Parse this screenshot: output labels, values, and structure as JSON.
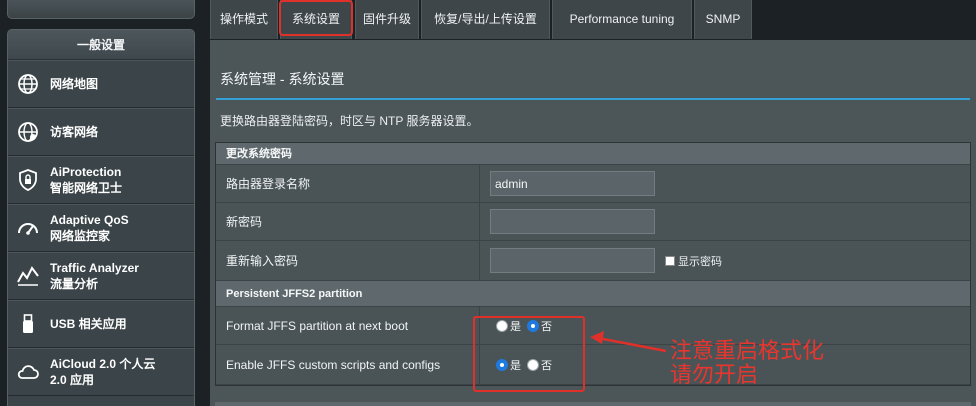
{
  "sidebar": {
    "header": "一般设置",
    "items": [
      {
        "icon": "globe-map-icon",
        "label": "网络地图",
        "sub": ""
      },
      {
        "icon": "guest-network-icon",
        "label": "访客网络",
        "sub": ""
      },
      {
        "icon": "shield-lock-icon",
        "label": "AiProtection",
        "sub": "智能网络卫士"
      },
      {
        "icon": "speedometer-icon",
        "label": "Adaptive QoS",
        "sub": "网络监控家"
      },
      {
        "icon": "traffic-analyzer-icon",
        "label": "Traffic Analyzer",
        "sub": "流量分析"
      },
      {
        "icon": "usb-icon",
        "label": "USB 相关应用",
        "sub": ""
      },
      {
        "icon": "cloud-icon",
        "label": "AiCloud 2.0 个人云",
        "sub": "2.0 应用"
      }
    ]
  },
  "tabs": [
    {
      "label": "操作模式"
    },
    {
      "label": "系统设置"
    },
    {
      "label": "固件升级"
    },
    {
      "label": "恢复/导出/上传设置"
    },
    {
      "label": "Performance tuning"
    },
    {
      "label": "SNMP"
    }
  ],
  "page": {
    "title": "系统管理 - 系统设置",
    "description": "更换路由器登陆密码，时区与 NTP 服务器设置。"
  },
  "password_section": {
    "header": "更改系统密码",
    "login_name_label": "路由器登录名称",
    "login_name_value": "admin",
    "new_password_label": "新密码",
    "confirm_password_label": "重新输入密码",
    "show_password_label": "显示密码"
  },
  "jffs_section": {
    "header": "Persistent JFFS2 partition",
    "format_label": "Format JFFS partition at next boot",
    "format_selected": "no",
    "scripts_label": "Enable JFFS custom scripts and configs",
    "scripts_selected": "yes",
    "yes_label": "是",
    "no_label": "否"
  },
  "annotation": {
    "line1": "注意重启格式化",
    "line2": "请勿开启"
  },
  "colors": {
    "accent_blue": "#34a1d6",
    "annotation_red": "#e0302a",
    "radio_selected": "#1f7ae0"
  }
}
